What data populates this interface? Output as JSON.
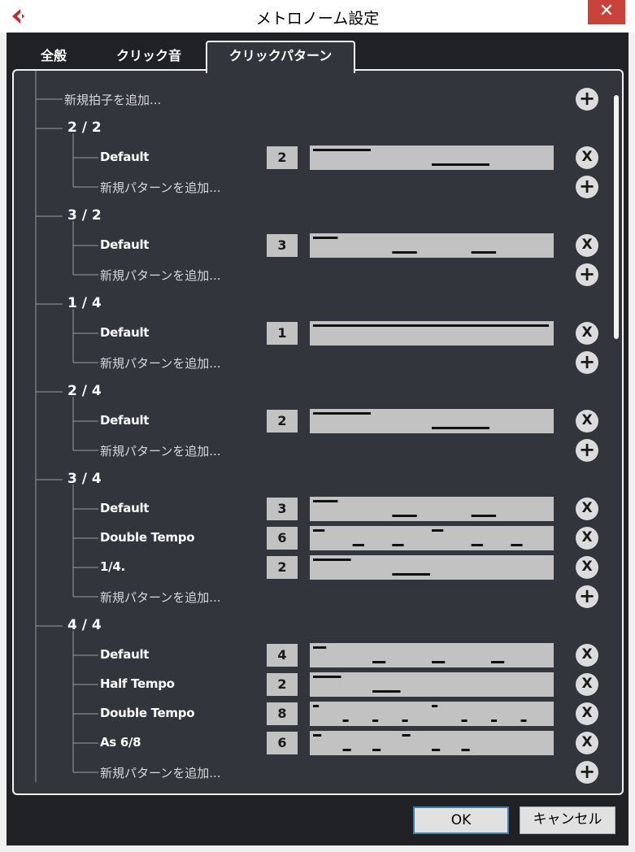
{
  "window": {
    "title": "メトロノーム設定",
    "close_glyph": "✕"
  },
  "tabs": [
    {
      "label": "全般"
    },
    {
      "label": "クリック音"
    },
    {
      "label": "クリックパターン",
      "active": true
    }
  ],
  "tree": {
    "add_signature_label": "新規拍子を追加...",
    "add_pattern_label": "新規パターンを追加...",
    "add_button_glyph": "+",
    "delete_button_glyph": "X",
    "signatures": [
      {
        "name": "2 / 2",
        "patterns": [
          {
            "name": "Default",
            "count": "2",
            "clicks": [
              {
                "start": 0,
                "len": 0.5,
                "accent": true
              },
              {
                "start": 1,
                "len": 0.5,
                "accent": false
              }
            ]
          }
        ]
      },
      {
        "name": "3 / 2",
        "patterns": [
          {
            "name": "Default",
            "count": "3",
            "clicks": [
              {
                "start": 0,
                "len": 0.333,
                "accent": true
              },
              {
                "start": 1,
                "len": 0.333,
                "accent": false
              },
              {
                "start": 2,
                "len": 0.333,
                "accent": false
              }
            ]
          }
        ]
      },
      {
        "name": "1 / 4",
        "patterns": [
          {
            "name": "Default",
            "count": "1",
            "clicks": [
              {
                "start": 0,
                "len": 1,
                "accent": true
              }
            ]
          }
        ]
      },
      {
        "name": "2 / 4",
        "patterns": [
          {
            "name": "Default",
            "count": "2",
            "clicks": [
              {
                "start": 0,
                "len": 0.5,
                "accent": true
              },
              {
                "start": 1,
                "len": 0.5,
                "accent": false
              }
            ]
          }
        ]
      },
      {
        "name": "3 / 4",
        "patterns": [
          {
            "name": "Default",
            "count": "3",
            "clicks": [
              {
                "start": 0,
                "len": 0.333,
                "accent": true
              },
              {
                "start": 1,
                "len": 0.333,
                "accent": false
              },
              {
                "start": 2,
                "len": 0.333,
                "accent": false
              }
            ]
          },
          {
            "name": "Double Tempo",
            "count": "6",
            "clicks": [
              {
                "start": 0,
                "len": 0.167,
                "accent": true
              },
              {
                "start": 0.5,
                "len": 0.167,
                "accent": false
              },
              {
                "start": 1,
                "len": 0.167,
                "accent": false
              },
              {
                "start": 1.5,
                "len": 0.167,
                "accent": true
              },
              {
                "start": 2,
                "len": 0.167,
                "accent": false
              },
              {
                "start": 2.5,
                "len": 0.167,
                "accent": false
              }
            ]
          },
          {
            "name": "1/4.",
            "count": "2",
            "clicks": [
              {
                "start": 0,
                "len": 0.5,
                "accent": true
              },
              {
                "start": 1,
                "len": 0.5,
                "accent": false
              }
            ]
          }
        ]
      },
      {
        "name": "4 / 4",
        "patterns": [
          {
            "name": "Default",
            "count": "4",
            "clicks": [
              {
                "start": 0,
                "len": 0.25,
                "accent": true
              },
              {
                "start": 1,
                "len": 0.25,
                "accent": false
              },
              {
                "start": 2,
                "len": 0.25,
                "accent": false
              },
              {
                "start": 3,
                "len": 0.25,
                "accent": false
              }
            ]
          },
          {
            "name": "Half Tempo",
            "count": "2",
            "clicks": [
              {
                "start": 0,
                "len": 0.5,
                "accent": true
              },
              {
                "start": 1,
                "len": 0.5,
                "accent": false
              }
            ]
          },
          {
            "name": "Double Tempo",
            "count": "8",
            "clicks": [
              {
                "start": 0,
                "len": 0.125,
                "accent": true
              },
              {
                "start": 0.5,
                "len": 0.125,
                "accent": false
              },
              {
                "start": 1,
                "len": 0.125,
                "accent": false
              },
              {
                "start": 1.5,
                "len": 0.125,
                "accent": false
              },
              {
                "start": 2,
                "len": 0.125,
                "accent": true
              },
              {
                "start": 2.5,
                "len": 0.125,
                "accent": false
              },
              {
                "start": 3,
                "len": 0.125,
                "accent": false
              },
              {
                "start": 3.5,
                "len": 0.125,
                "accent": false
              }
            ]
          },
          {
            "name": "As 6/8",
            "count": "6",
            "clicks": [
              {
                "start": 0,
                "len": 0.167,
                "accent": true
              },
              {
                "start": 0.5,
                "len": 0.167,
                "accent": false
              },
              {
                "start": 1,
                "len": 0.167,
                "accent": false
              },
              {
                "start": 1.5,
                "len": 0.167,
                "accent": true
              },
              {
                "start": 2,
                "len": 0.167,
                "accent": false
              },
              {
                "start": 2.5,
                "len": 0.167,
                "accent": false
              }
            ]
          }
        ]
      }
    ]
  },
  "footer": {
    "ok_label": "OK",
    "cancel_label": "キャンセル"
  },
  "colors": {
    "background": "#1f2125",
    "panel": "#32353b",
    "pattern_box": "#c2c2c2",
    "close": "#c8423a",
    "brand": "#c62a2a"
  }
}
